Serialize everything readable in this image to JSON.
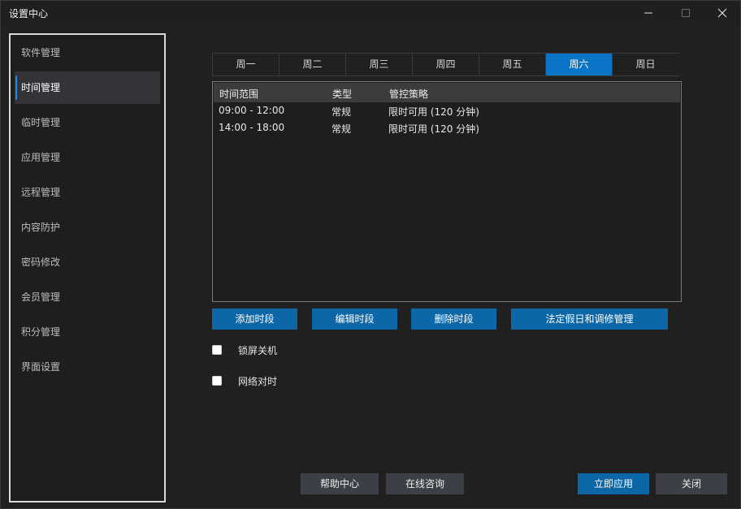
{
  "window": {
    "title": "设置中心"
  },
  "sidebar": {
    "items": [
      {
        "label": "软件管理"
      },
      {
        "label": "时间管理"
      },
      {
        "label": "临时管理"
      },
      {
        "label": "应用管理"
      },
      {
        "label": "远程管理"
      },
      {
        "label": "内容防护"
      },
      {
        "label": "密码修改"
      },
      {
        "label": "会员管理"
      },
      {
        "label": "积分管理"
      },
      {
        "label": "界面设置"
      }
    ],
    "active": "时间管理"
  },
  "tabs": {
    "items": [
      "周一",
      "周二",
      "周三",
      "周四",
      "周五",
      "周六",
      "周日"
    ],
    "active": "周六"
  },
  "table": {
    "columns": [
      "时间范围",
      "类型",
      "管控策略"
    ],
    "rows": [
      [
        "09:00 - 12:00",
        "常规",
        "限时可用 (120 分钟)"
      ],
      [
        "14:00 - 18:00",
        "常规",
        "限时可用 (120 分钟)"
      ]
    ]
  },
  "actions": {
    "add": "添加时段",
    "edit": "编辑时段",
    "delete": "删除时段",
    "holiday": "法定假日和调修管理"
  },
  "options": {
    "lock_shutdown": {
      "label": "锁屏关机",
      "checked": false
    },
    "network_time": {
      "label": "网络对时",
      "checked": false
    }
  },
  "footer": {
    "help": "帮助中心",
    "consult": "在线咨询",
    "apply": "立即应用",
    "close": "关闭"
  },
  "colors": {
    "accent": "#0a74c6",
    "background": "#202020"
  }
}
